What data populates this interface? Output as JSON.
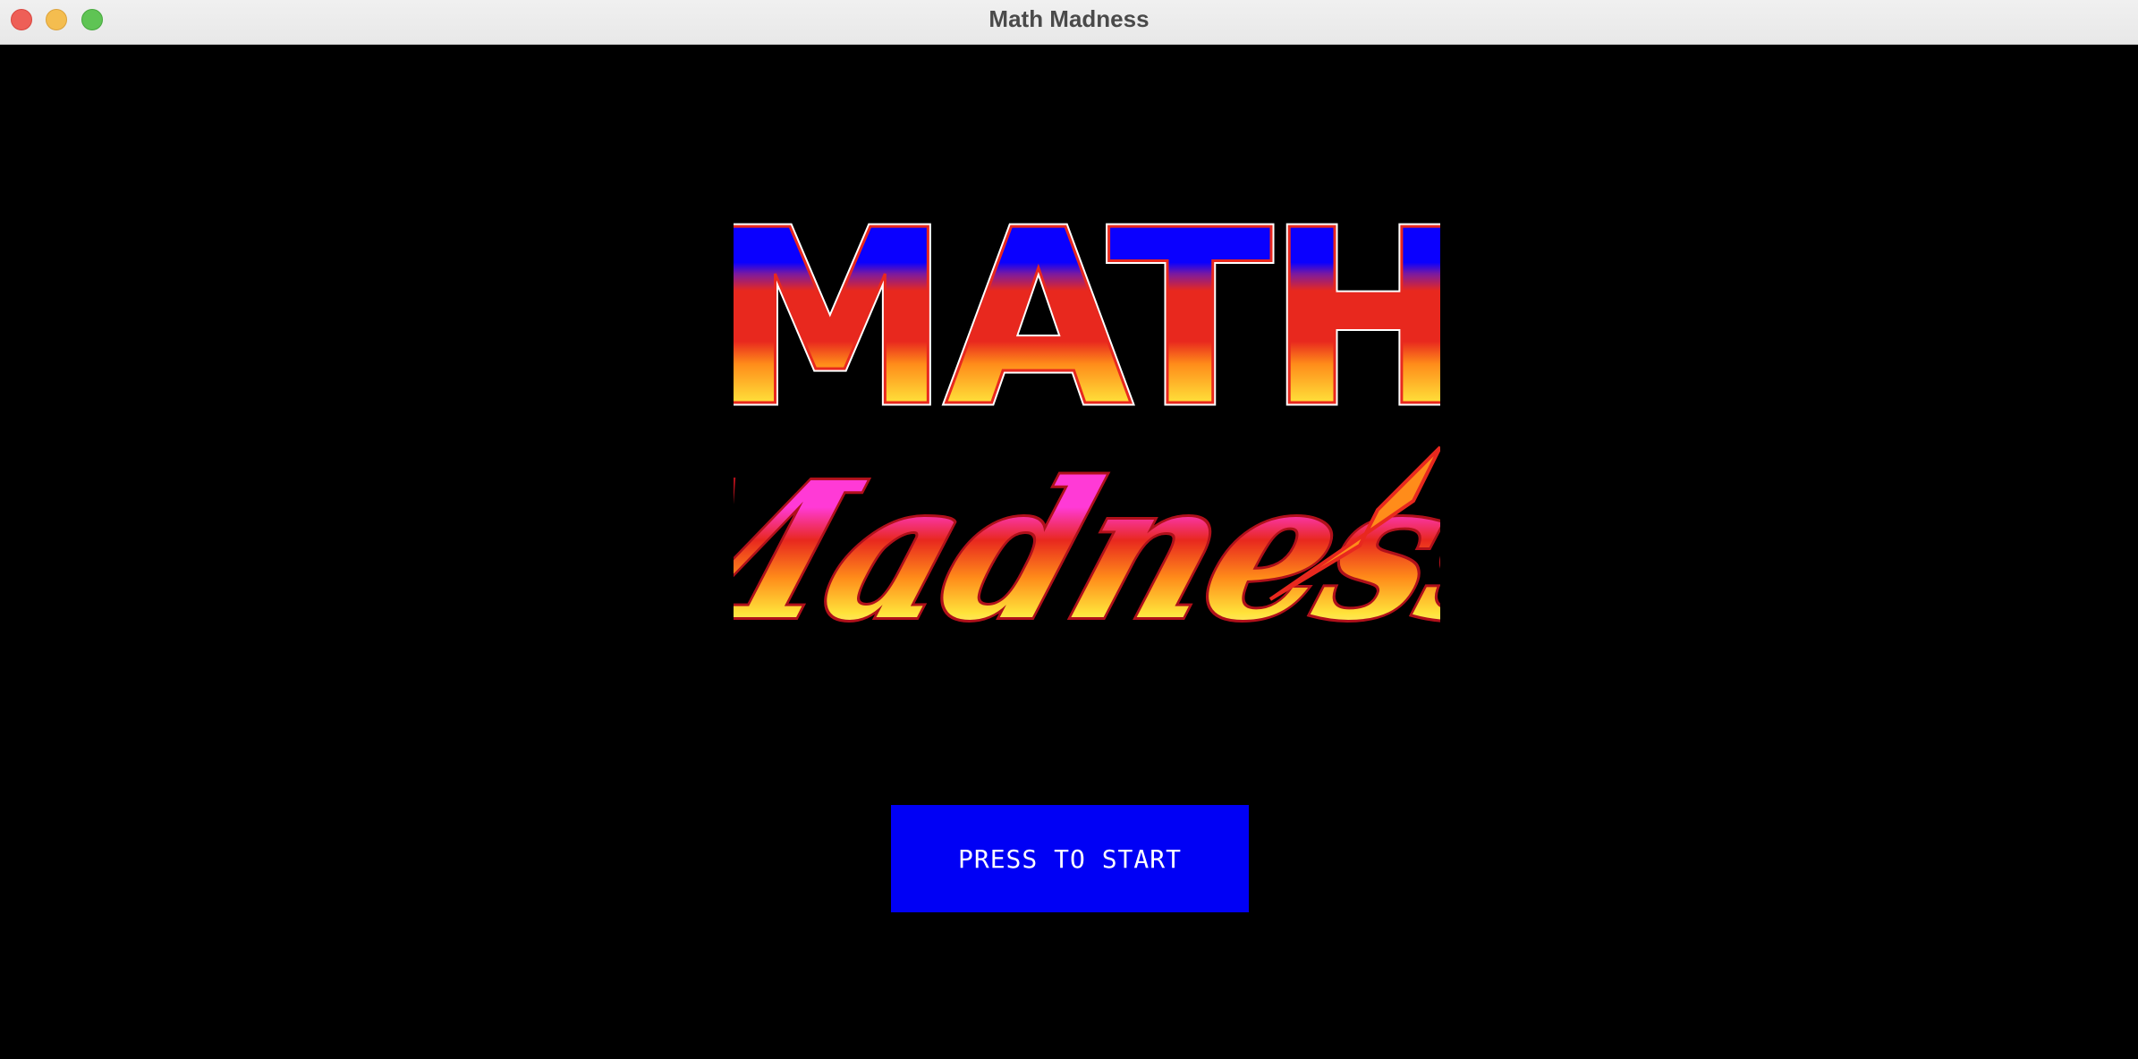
{
  "window": {
    "title": "Math Madness",
    "controls": [
      "close",
      "minimize",
      "maximize"
    ]
  },
  "logo": {
    "line1": "MATH",
    "line2": "Madness",
    "colors": {
      "blue": "#0a00ff",
      "red": "#e8281e",
      "orange": "#ff8c1a",
      "yellow": "#ffe23a",
      "magenta": "#ff3ad6",
      "white": "#ffffff"
    }
  },
  "start_button": {
    "label": "PRESS TO START",
    "color": "#0000f5"
  }
}
